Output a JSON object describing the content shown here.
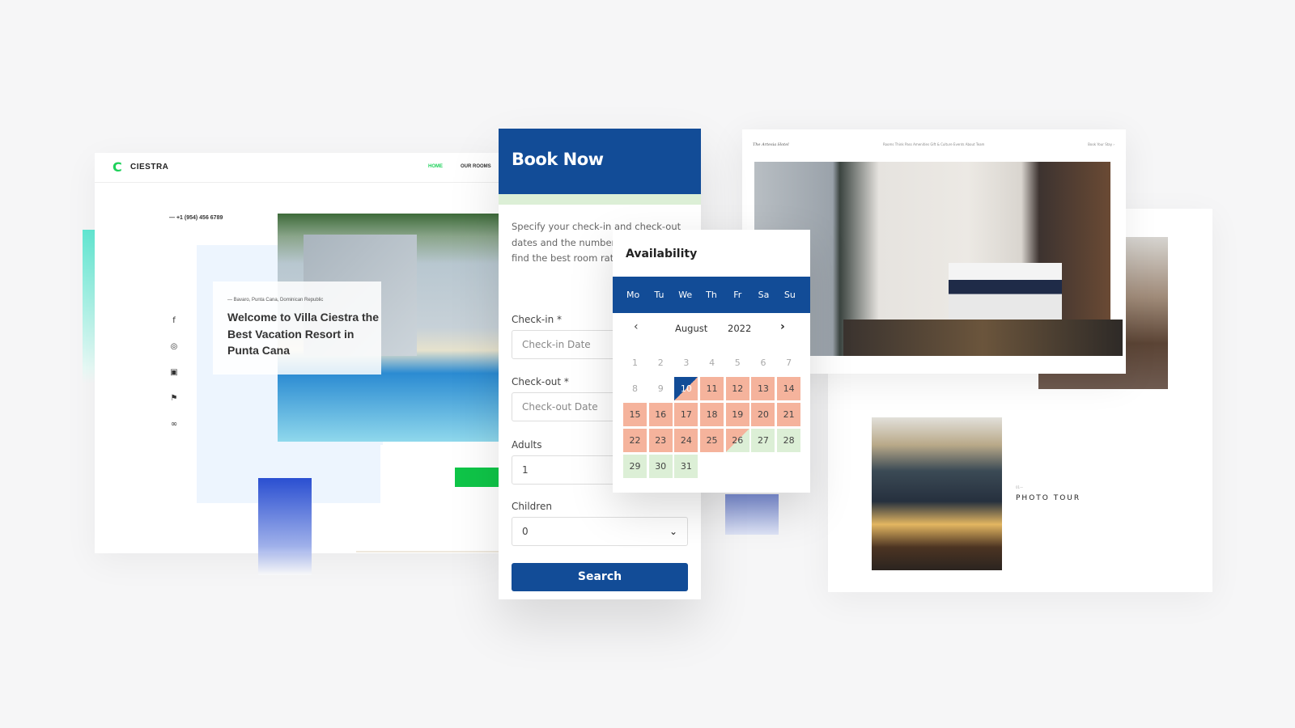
{
  "left_site": {
    "logo_mark": "C",
    "logo_text": "CIESTRA",
    "nav": [
      "HOME",
      "OUR ROOMS"
    ],
    "accent": "#1ed15a",
    "phone": "—  +1 (954) 456 6789",
    "hero_subtitle": "— Bavaro, Punta Cana, Dominican Republic",
    "hero_title": "Welcome to Villa Ciestra the Best Vacation Resort in Punta Cana",
    "social_icons": [
      "f",
      "◎",
      "▣",
      "⚑",
      "∞"
    ]
  },
  "right_site": {
    "title": "The Artesia Hotel",
    "nav": "Rooms  Think Pass  Amenities  Gift & Culture  Events  About  Team",
    "book_link": "Book Your Stay ›",
    "photo_tour_dash": "01—",
    "photo_tour": "PHOTO TOUR"
  },
  "booking": {
    "title": "Book Now",
    "brand_color": "#124c97",
    "description": "Specify your check-in and check-out dates and the number of guests to find the best room rates online easily.",
    "checkin_label": "Check-in *",
    "checkin_placeholder": "Check-in Date",
    "checkout_label": "Check-out *",
    "checkout_placeholder": "Check-out Date",
    "adults_label": "Adults",
    "adults_value": "1",
    "children_label": "Children",
    "children_value": "0",
    "search_label": "Search"
  },
  "availability": {
    "title": "Availability",
    "weekdays": [
      "Mo",
      "Tu",
      "We",
      "Th",
      "Fr",
      "Sa",
      "Su"
    ],
    "month": "August",
    "year": "2022",
    "prev": "‹",
    "next": "›",
    "days": [
      {
        "d": "1",
        "s": "past"
      },
      {
        "d": "2",
        "s": "past"
      },
      {
        "d": "3",
        "s": "past"
      },
      {
        "d": "4",
        "s": "past"
      },
      {
        "d": "5",
        "s": "past"
      },
      {
        "d": "6",
        "s": "past"
      },
      {
        "d": "7",
        "s": "past"
      },
      {
        "d": "8",
        "s": "past"
      },
      {
        "d": "9",
        "s": "past"
      },
      {
        "d": "10",
        "s": "checkin"
      },
      {
        "d": "11",
        "s": "booked"
      },
      {
        "d": "12",
        "s": "booked"
      },
      {
        "d": "13",
        "s": "booked"
      },
      {
        "d": "14",
        "s": "booked"
      },
      {
        "d": "15",
        "s": "booked"
      },
      {
        "d": "16",
        "s": "booked"
      },
      {
        "d": "17",
        "s": "booked"
      },
      {
        "d": "18",
        "s": "booked"
      },
      {
        "d": "19",
        "s": "booked"
      },
      {
        "d": "20",
        "s": "booked"
      },
      {
        "d": "21",
        "s": "booked"
      },
      {
        "d": "22",
        "s": "booked"
      },
      {
        "d": "23",
        "s": "booked"
      },
      {
        "d": "24",
        "s": "booked"
      },
      {
        "d": "25",
        "s": "booked"
      },
      {
        "d": "26",
        "s": "checkout"
      },
      {
        "d": "27",
        "s": "free"
      },
      {
        "d": "28",
        "s": "free"
      },
      {
        "d": "29",
        "s": "free"
      },
      {
        "d": "30",
        "s": "free"
      },
      {
        "d": "31",
        "s": "free"
      }
    ],
    "colors": {
      "booked": "#f5b39c",
      "free": "#dcefd6",
      "selected": "#124c97"
    }
  }
}
